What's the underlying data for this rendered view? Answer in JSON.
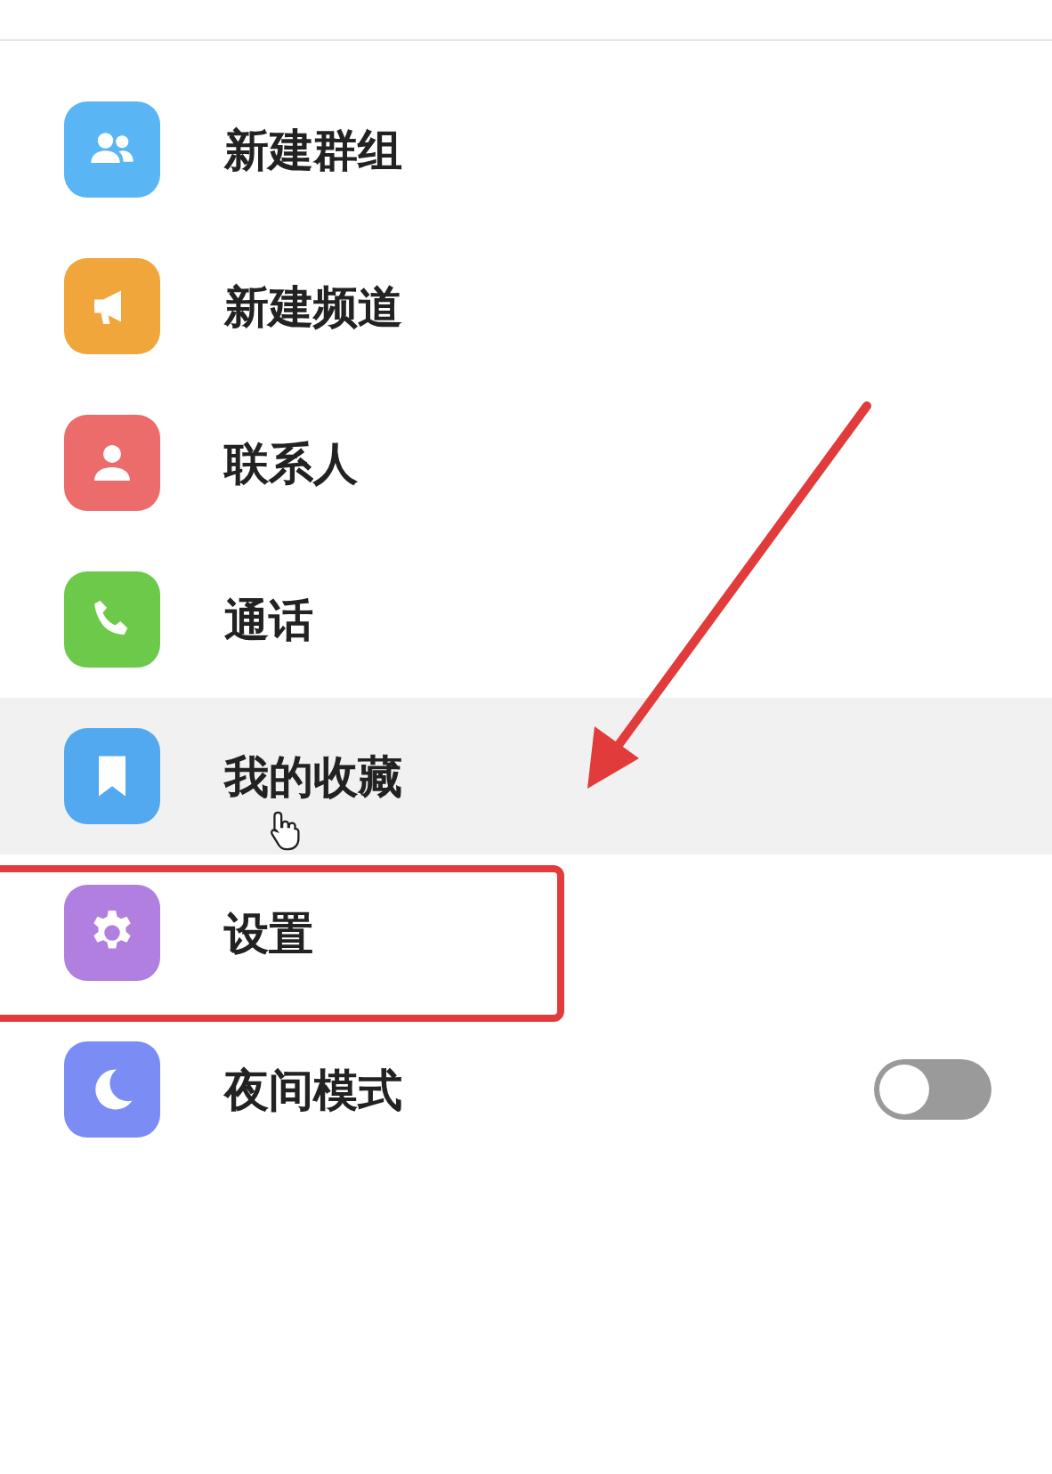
{
  "menu": {
    "items": [
      {
        "kind": "link",
        "label": "新建群组",
        "color": "#5ab5f5",
        "hovered": false,
        "boxed": false
      },
      {
        "kind": "link",
        "label": "新建频道",
        "color": "#f0a63a",
        "hovered": false,
        "boxed": false
      },
      {
        "kind": "link",
        "label": "联系人",
        "color": "#ec6b6b",
        "hovered": false,
        "boxed": false
      },
      {
        "kind": "link",
        "label": "通话",
        "color": "#6cc94a",
        "hovered": false,
        "boxed": false
      },
      {
        "kind": "link",
        "label": "我的收藏",
        "color": "#52a9f0",
        "hovered": true,
        "boxed": false
      },
      {
        "kind": "link",
        "label": "设置",
        "color": "#b07fe0",
        "hovered": false,
        "boxed": true
      },
      {
        "kind": "toggle",
        "label": "夜间模式",
        "color": "#7b8cf5",
        "hovered": false,
        "boxed": false,
        "on": false
      }
    ]
  }
}
